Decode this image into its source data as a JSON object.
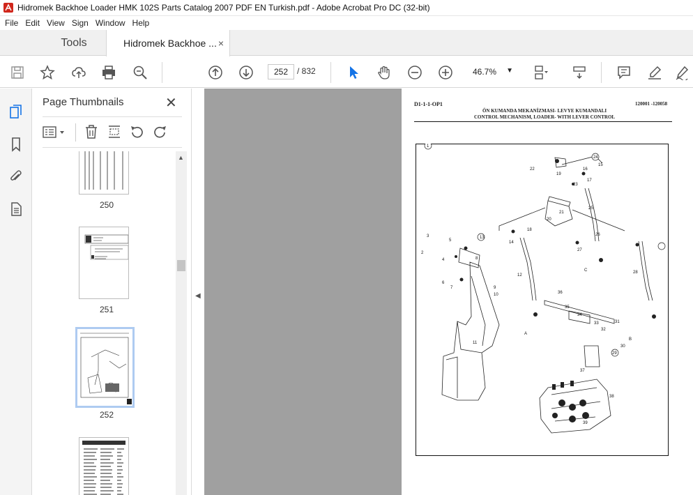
{
  "window": {
    "title": "Hidromek Backhoe Loader HMK 102S Parts Catalog 2007 PDF EN Turkish.pdf - Adobe Acrobat Pro DC (32-bit)"
  },
  "menu": [
    "File",
    "Edit",
    "View",
    "Sign",
    "Window",
    "Help"
  ],
  "tabs": {
    "tools": "Tools",
    "document": "Hidromek Backhoe ...",
    "close_glyph": "×"
  },
  "toolbar": {
    "current_page": "252",
    "total_pages": "/ 832",
    "zoom": "46.7%",
    "icons": [
      "save-icon",
      "bookmark-star-icon",
      "upload-icon",
      "print-icon",
      "zoom-search-icon",
      "prev-page-icon",
      "next-page-icon",
      "select-cursor-icon",
      "hand-icon",
      "zoom-out-icon",
      "zoom-in-icon",
      "page-display-icon",
      "scroll-mode-icon",
      "comment-icon",
      "highlight-icon",
      "sign-icon"
    ]
  },
  "left_rail": {
    "icons": [
      "page-thumbnails-icon",
      "bookmarks-icon",
      "attachments-icon",
      "document-icon"
    ]
  },
  "panel": {
    "title": "Page Thumbnails",
    "close_glyph": "✕",
    "thumbnails": [
      {
        "label": "250"
      },
      {
        "label": "251"
      },
      {
        "label": "252",
        "selected": true
      },
      {
        "label": ""
      }
    ]
  },
  "pdf": {
    "code": "D1-1-1-OP1",
    "serial": "120001 -120058",
    "title_tr": "ÖN KUMANDA MEKANİZMASI- LEVYE KUMANDALI",
    "title_en": "CONTROL MECHANISM, LOADER- WITH LEVER CONTROL",
    "callouts": [
      "1",
      "2",
      "3",
      "4",
      "5",
      "6",
      "7",
      "8",
      "9",
      "10",
      "11",
      "12",
      "13",
      "14",
      "15",
      "16",
      "17",
      "18",
      "19",
      "20",
      "21",
      "22",
      "23",
      "24",
      "25",
      "26",
      "27",
      "28",
      "29",
      "30",
      "31",
      "32",
      "33",
      "34",
      "35",
      "36",
      "37",
      "38",
      "39",
      "A",
      "B",
      "C"
    ]
  },
  "colors": {
    "accent": "#1473e6",
    "canvas": "#a0a0a0",
    "thumb_selected": "#aecbf1"
  }
}
